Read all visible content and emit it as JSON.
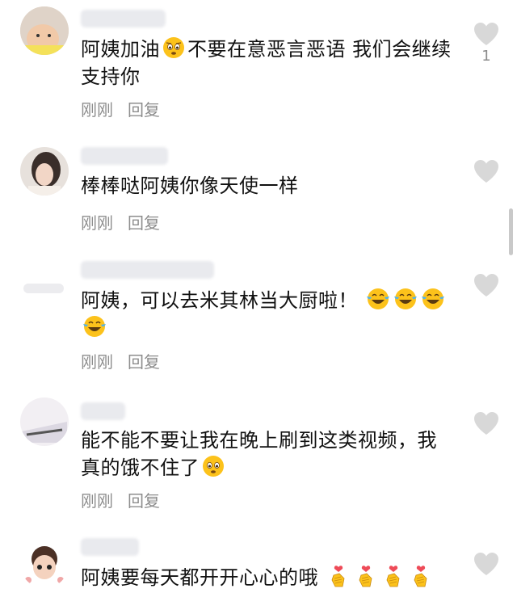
{
  "comments": [
    {
      "text_parts": [
        "阿姨加油",
        "不要在意恶言恶语 我们会继续支持你"
      ],
      "emoji_after_first": "worried-face-emoji",
      "action_time": "刚刚",
      "action_reply": "回复",
      "likes": "1"
    },
    {
      "text": "棒棒哒阿姨你像天使一样",
      "action_time": "刚刚",
      "action_reply": "回复"
    },
    {
      "text": "阿姨，可以去米其林当大厨啦！",
      "emoji": "laughing-tears-emoji",
      "action_time": "刚刚",
      "action_reply": "回复"
    },
    {
      "text": "能不能不要让我在晚上刷到这类视频，我真的饿不住了",
      "emoji": "worried-face-emoji",
      "action_time": "刚刚",
      "action_reply": "回复"
    },
    {
      "text": "阿姨要每天都开开心心的哦",
      "emoji": "finger-heart-emoji",
      "action_time": "",
      "action_reply": ""
    }
  ],
  "colors": {
    "text": "#111111",
    "meta": "#8d8d8d",
    "like_icon": "#d8d8d8",
    "emoji_yellow": "#fcc21b"
  }
}
